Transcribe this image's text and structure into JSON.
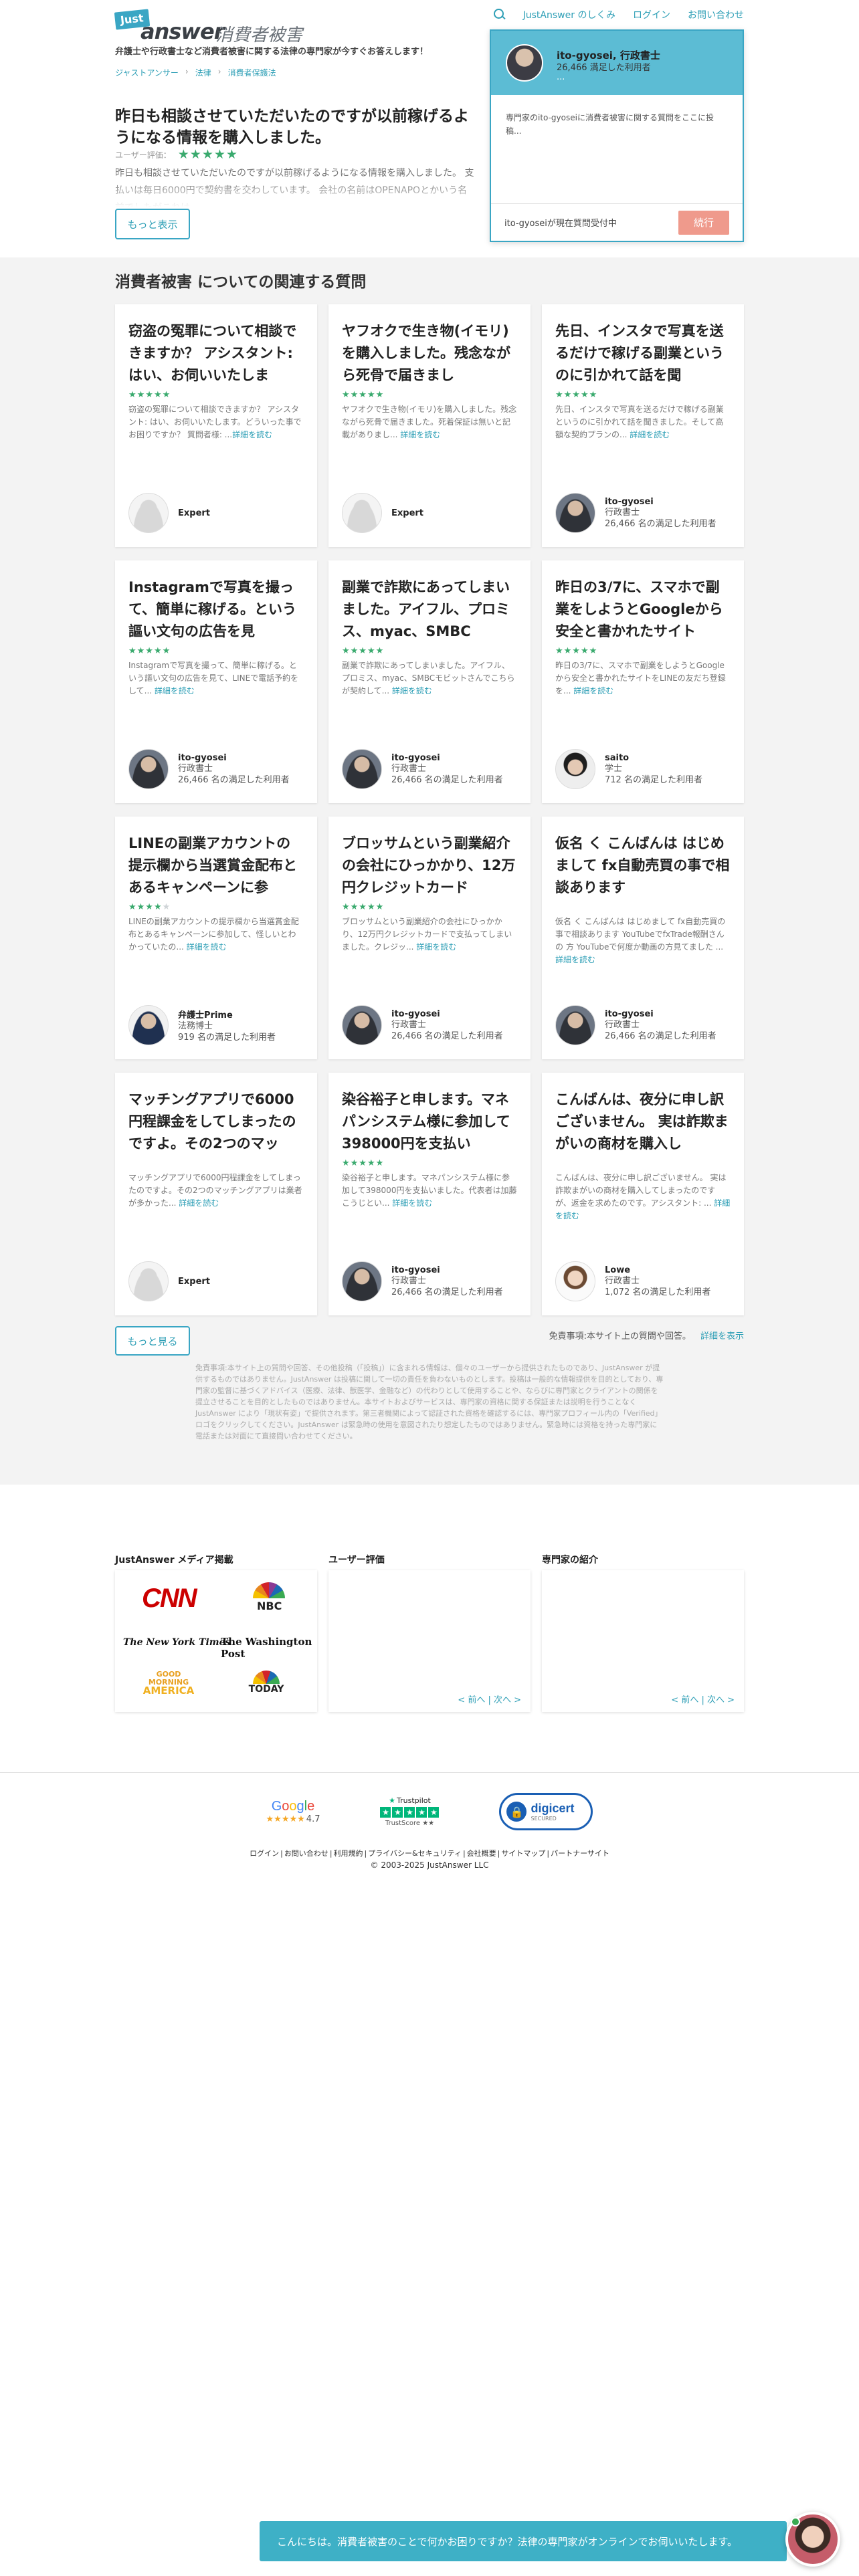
{
  "header": {
    "logo_just": "Just",
    "logo_answer": "answer",
    "logo_site": "消費者被害",
    "tagline": "弁護士や行政書士など消費者被害に関する法律の専門家が今すぐお答えします！",
    "nav": {
      "how": "JustAnswer のしくみ",
      "login": "ログイン",
      "contact": "お問い合わせ"
    }
  },
  "breadcrumbs": [
    "ジャストアンサー",
    "法律",
    "消費者保護法"
  ],
  "question": {
    "title": "昨日も相談させていただいたのですが以前稼げるようになる情報を購入しました。",
    "rating_label": "ユーザー評価：",
    "stars": "★★★★★",
    "desc": "昨日も相談させていただいたのですが以前稼げるようになる情報を購入しました。 支払いは毎日6000円で契約書を交わしています。 会社の名前はOPENAPOとかいう名前でしたがこれは",
    "more": "もっと表示"
  },
  "chat": {
    "expert_name": "ito-gyosei, 行政書士",
    "expert_sub": "26,466 満足した利用者",
    "dots": "...",
    "message": "専門家のito-gyoseiに消費者被害に関する質問をここに投稿...",
    "status": "ito-gyoseiが現在質問受付中",
    "go": "続行"
  },
  "related": {
    "title": "消費者被害 についての関連する質問",
    "read_more": "詳細を読む",
    "cards": [
      {
        "title": "窃盗の冤罪について相談できますか？ アシスタント: はい、お伺いいたしま",
        "stars": "★★★★★",
        "excerpt": "窃盗の冤罪について相談できますか？ アシスタント: はい、お伺いいたします。どういった事でお困りですか？ 質問者様: ...",
        "name": "Expert",
        "title_line": "",
        "count": ""
      },
      {
        "title": "ヤフオクで生き物(イモリ)を購入しました。残念ながら死骨で届きまし",
        "stars": "★★★★★",
        "excerpt": "ヤフオクで生き物(イモリ)を購入しました。残念ながら死骨で届きました。死着保証は無いと記載がありまし... ",
        "name": "Expert",
        "title_line": "",
        "count": ""
      },
      {
        "title": "先日、インスタで写真を送るだけで稼げる副業というのに引かれて話を聞",
        "stars": "★★★★★",
        "excerpt": "先日、インスタで写真を送るだけで稼げる副業というのに引かれて話を聞きました。そして高額な契約プランの... ",
        "name": "ito-gyosei",
        "title_line": "行政書士",
        "count": "26,466 名の満足した利用者"
      },
      {
        "title": "Instagramで写真を撮って、簡単に稼げる。という謳い文句の広告を見",
        "stars": "★★★★★",
        "excerpt": "Instagramで写真を撮って、簡単に稼げる。という謳い文句の広告を見て、LINEで電話予約をして... ",
        "name": "ito-gyosei",
        "title_line": "行政書士",
        "count": "26,466 名の満足した利用者"
      },
      {
        "title": "副業で詐欺にあってしまいました。アイフル、プロミス、myac、SMBC",
        "stars": "★★★★★",
        "excerpt": "副業で詐欺にあってしまいました。アイフル、プロミス、myac、SMBCモビットさんでこちらが契約して... ",
        "name": "ito-gyosei",
        "title_line": "行政書士",
        "count": "26,466 名の満足した利用者"
      },
      {
        "title": "昨日の3/7に、スマホで副業をしようとGoogleから安全と書かれたサイト",
        "stars": "★★★★★",
        "excerpt": "昨日の3/7に、スマホで副業をしようとGoogleから安全と書かれたサイトをLINEの友だち登録を... ",
        "name": "saito",
        "title_line": "学士",
        "count": "712 名の満足した利用者"
      },
      {
        "title": "LINEの副業アカウントの提示欄から当選賞金配布とあるキャンペーンに参",
        "stars": "★★★★",
        "stars_off": "★",
        "excerpt": "LINEの副業アカウントの提示欄から当選賞金配布とあるキャンペーンに参加して、怪しいとわかっていたの... ",
        "name": "弁護士Prime",
        "title_line": "法務博士",
        "count": "919 名の満足した利用者"
      },
      {
        "title": "ブロッサムという副業紹介の会社にひっかかり、12万円クレジットカード",
        "stars": "★★★★★",
        "excerpt": "ブロッサムという副業紹介の会社にひっかかり、12万円クレジットカードで支払ってしまいました。クレジッ... ",
        "name": "ito-gyosei",
        "title_line": "行政書士",
        "count": "26,466 名の満足した利用者"
      },
      {
        "title": "仮名 く こんばんは はじめまして fx自動売買の事で相談あります",
        "stars": "",
        "excerpt": "仮名 く こんばんは はじめまして fx自動売買の事で相談あります YouTubeでfxTrade報酬さんの 方 YouTubeで何度か動画の方見てました ... ",
        "name": "ito-gyosei",
        "title_line": "行政書士",
        "count": "26,466 名の満足した利用者"
      },
      {
        "title": "マッチングアプリで6000円程課金をしてしまったのですよ。その2つのマッ",
        "stars": "",
        "excerpt": "マッチングアプリで6000円程課金をしてしまったのですよ。その2つのマッチングアプリは業者が多かった... ",
        "name": "Expert",
        "title_line": "",
        "count": ""
      },
      {
        "title": "染谷裕子と申します。マネパンシステム様に参加して398000円を支払い",
        "stars": "★★★★★",
        "excerpt": "染谷裕子と申します。マネパンシステム様に参加して398000円を支払いました。代表者は加藤こうじとい... ",
        "name": "ito-gyosei",
        "title_line": "行政書士",
        "count": "26,466 名の満足した利用者"
      },
      {
        "title": "こんばんは、夜分に申し訳ございません。 実は詐欺まがいの商材を購入し",
        "stars": "",
        "excerpt": "こんばんは、夜分に申し訳ございません。 実は詐欺まがいの商材を購入してしまったのですが、返金を求めたのです。アシスタント: ... ",
        "name": "Lowe",
        "title_line": "行政書士",
        "count": "1,072 名の満足した利用者"
      }
    ],
    "see_more": "もっと見る",
    "disclaimer_title": "免責事項:本サイト上の質問や回答。",
    "disclaimer_link": "詳細を表示",
    "disclaimer_text": "免責事項:本サイト上の質問や回答、その他投稿（「投稿」）に含まれる情報は、個々のユーザーから提供されたものであり、JustAnswer が提供するものではありません。JustAnswer は投稿に関して一切の責任を負わないものとします。投稿は一般的な情報提供を目的としており、専門家の監督に基づくアドバイス（医療、法律、獣医学、金融など）の代わりとして使用することや、ならびに専門家とクライアントの関係を提立させることを目的としたものではありません。本サイトおよびサービスは、専門家の資格に関する保証または説明を行うことなく JustAnswer により「現状有姿」で提供されます。第三者機関によって認証された資格を確認するには、専門家プロフィール内の「Verified」ロゴをクリックしてください。JustAnswer は緊急時の使用を意図されたり想定したものではありません。緊急時には資格を持った専門家に電話または対面にて直接問い合わせてください。"
  },
  "media": {
    "col1": "JustAnswer メディア掲載",
    "col2": "ユーザー評価",
    "col3": "専門家の紹介",
    "logos": {
      "cnn": "CNN",
      "nbc": "NBC",
      "nyt": "The New York Times",
      "wp": "The Washington Post",
      "gma_small": "GOOD MORNING",
      "gma_big": "AMERICA",
      "today": "TODAY"
    },
    "pager": "< 前へ | 次へ >"
  },
  "footer": {
    "google": "Google",
    "google_stars": "★★★★★",
    "google_score": "4.7",
    "tp_head": "Trustpilot",
    "tp_score": "TrustScore ★★",
    "digicert": "digicert",
    "digicert_sub": "SECURED",
    "links": [
      "ログイン",
      "お問い合わせ",
      "利用規約",
      "プライバシー&セキュリティ",
      "会社概要",
      "サイトマップ",
      "パートナーサイト"
    ],
    "copyright": "© 2003-2025 JustAnswer LLC"
  },
  "bubble": {
    "text": "こんにちは。消費者被害のことで何かお困りですか？法律の専門家がオンラインでお伺いいたします。"
  }
}
